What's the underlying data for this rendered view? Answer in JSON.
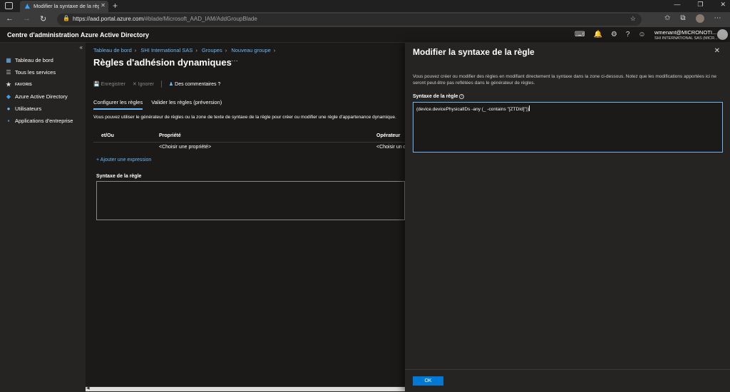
{
  "browser": {
    "tab_title": "Modifier la syntaxe de la règle · ",
    "url_host": "https://aad.portal.azure.com",
    "url_path": "/#blade/Microsoft_AAD_IAM/AddGroupBlade"
  },
  "portal": {
    "title": "Centre d'administration Azure Active Directory",
    "user_name": "wmenant@MICRONOTI...",
    "user_org": "SHI INTERNATIONAL SAS (MICR..."
  },
  "sidebar": {
    "items": [
      {
        "label": "Tableau de bord",
        "icon": "dashboard-icon"
      },
      {
        "label": "Tous les services",
        "icon": "list-icon"
      },
      {
        "label": "FAVORIS",
        "icon": "star-icon"
      },
      {
        "label": "Azure Active Directory",
        "icon": "aad-icon"
      },
      {
        "label": "Utilisateurs",
        "icon": "user-icon"
      },
      {
        "label": "Applications d'entreprise",
        "icon": "apps-icon"
      }
    ]
  },
  "main": {
    "breadcrumb": [
      "Tableau de bord",
      "SHI International SAS",
      "Groupes",
      "Nouveau groupe"
    ],
    "title": "Règles d'adhésion dynamiques",
    "toolbar": {
      "save": "Enregistrer",
      "discard": "Ignorer",
      "feedback": "Des commentaires ?"
    },
    "tabs": [
      "Configurer les règles",
      "Valider les règles (préversion)"
    ],
    "description": "Vous pouvez utiliser le générateur de règles ou la zone de texte de syntaxe de la règle pour créer ou modifier une règle d'appartenance dynamique.",
    "grid": {
      "headers": [
        "et/Ou",
        "Propriété",
        "Opérateur"
      ],
      "row": [
        "",
        "<Choisir une propriété>",
        "<Choisir un o"
      ]
    },
    "add_expression": "Ajouter une expression",
    "syntax_label": "Syntaxe de la règle"
  },
  "panel": {
    "title": "Modifier la syntaxe de la règle",
    "description": "Vous pouvez créer ou modifier des règles en modifiant directement la syntaxe dans la zone ci-dessous. Notez que les modifications apportées ici ne seront peut-être pas reflétées dans le générateur de règles.",
    "label": "Syntaxe de la règle",
    "value": "(device.devicePhysicalIDs -any (_ -contains \"[ZTDId]\"))",
    "ok": "OK"
  }
}
